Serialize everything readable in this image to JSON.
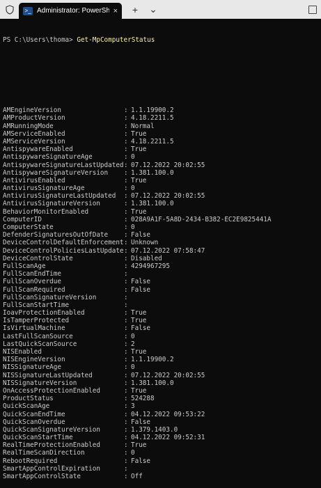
{
  "window": {
    "tab_title": "Administrator: PowerShell kla",
    "tab_close": "×",
    "new_tab": "+",
    "dropdown": "⌄"
  },
  "console": {
    "prompt": "PS C:\\Users\\thoma> ",
    "command": "Get-MpComputerStatus",
    "rows": [
      {
        "key": "AMEngineVersion",
        "value": "1.1.19900.2"
      },
      {
        "key": "AMProductVersion",
        "value": "4.18.2211.5"
      },
      {
        "key": "AMRunningMode",
        "value": "Normal"
      },
      {
        "key": "AMServiceEnabled",
        "value": "True"
      },
      {
        "key": "AMServiceVersion",
        "value": "4.18.2211.5"
      },
      {
        "key": "AntispywareEnabled",
        "value": "True"
      },
      {
        "key": "AntispywareSignatureAge",
        "value": "0"
      },
      {
        "key": "AntispywareSignatureLastUpdated",
        "value": "07.12.2022 20:02:55"
      },
      {
        "key": "AntispywareSignatureVersion",
        "value": "1.381.100.0"
      },
      {
        "key": "AntivirusEnabled",
        "value": "True"
      },
      {
        "key": "AntivirusSignatureAge",
        "value": "0"
      },
      {
        "key": "AntivirusSignatureLastUpdated",
        "value": "07.12.2022 20:02:55"
      },
      {
        "key": "AntivirusSignatureVersion",
        "value": "1.381.100.0"
      },
      {
        "key": "BehaviorMonitorEnabled",
        "value": "True"
      },
      {
        "key": "ComputerID",
        "value": "028A9A1F-5A8D-2434-B382-EC2E9825441A"
      },
      {
        "key": "ComputerState",
        "value": "0"
      },
      {
        "key": "DefenderSignaturesOutOfDate",
        "value": "False"
      },
      {
        "key": "DeviceControlDefaultEnforcement",
        "value": "Unknown"
      },
      {
        "key": "DeviceControlPoliciesLastUpdated",
        "value": "07.12.2022 07:58:47"
      },
      {
        "key": "DeviceControlState",
        "value": "Disabled"
      },
      {
        "key": "FullScanAge",
        "value": "4294967295"
      },
      {
        "key": "FullScanEndTime",
        "value": ""
      },
      {
        "key": "FullScanOverdue",
        "value": "False"
      },
      {
        "key": "FullScanRequired",
        "value": "False"
      },
      {
        "key": "FullScanSignatureVersion",
        "value": ""
      },
      {
        "key": "FullScanStartTime",
        "value": ""
      },
      {
        "key": "IoavProtectionEnabled",
        "value": "True"
      },
      {
        "key": "IsTamperProtected",
        "value": "True"
      },
      {
        "key": "IsVirtualMachine",
        "value": "False"
      },
      {
        "key": "LastFullScanSource",
        "value": "0"
      },
      {
        "key": "LastQuickScanSource",
        "value": "2"
      },
      {
        "key": "NISEnabled",
        "value": "True"
      },
      {
        "key": "NISEngineVersion",
        "value": "1.1.19900.2"
      },
      {
        "key": "NISSignatureAge",
        "value": "0"
      },
      {
        "key": "NISSignatureLastUpdated",
        "value": "07.12.2022 20:02:55"
      },
      {
        "key": "NISSignatureVersion",
        "value": "1.381.100.0"
      },
      {
        "key": "OnAccessProtectionEnabled",
        "value": "True"
      },
      {
        "key": "ProductStatus",
        "value": "524288"
      },
      {
        "key": "QuickScanAge",
        "value": "3"
      },
      {
        "key": "QuickScanEndTime",
        "value": "04.12.2022 09:53:22"
      },
      {
        "key": "QuickScanOverdue",
        "value": "False"
      },
      {
        "key": "QuickScanSignatureVersion",
        "value": "1.379.1403.0"
      },
      {
        "key": "QuickScanStartTime",
        "value": "04.12.2022 09:52:31"
      },
      {
        "key": "RealTimeProtectionEnabled",
        "value": "True"
      },
      {
        "key": "RealTimeScanDirection",
        "value": "0"
      },
      {
        "key": "RebootRequired",
        "value": "False"
      },
      {
        "key": "SmartAppControlExpiration",
        "value": ""
      },
      {
        "key": "SmartAppControlState",
        "value": "Off"
      }
    ]
  }
}
